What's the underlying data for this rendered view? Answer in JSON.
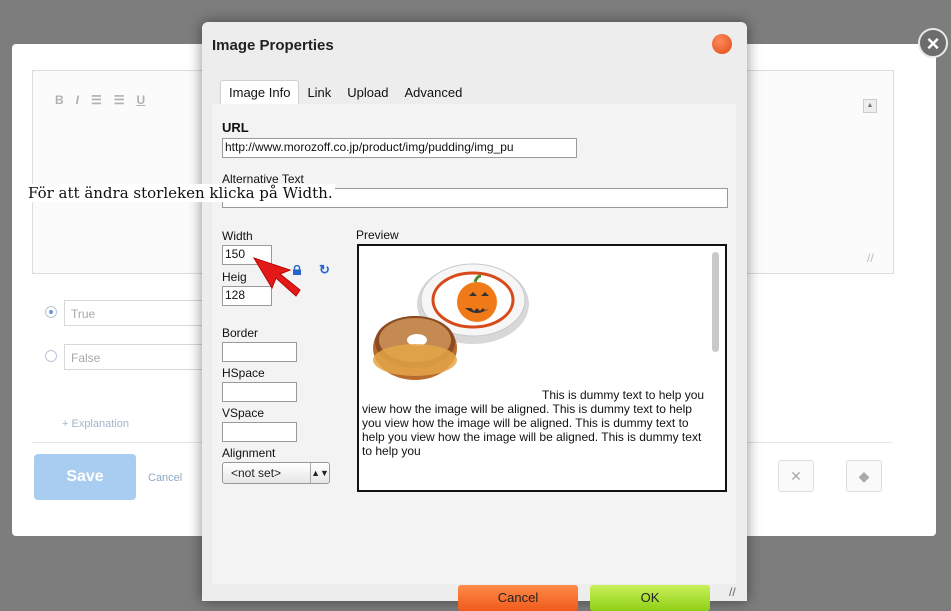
{
  "background": {
    "toolbar_icons": [
      "B",
      "I",
      "☰",
      "☰",
      "U"
    ],
    "options": [
      {
        "label": "True",
        "selected": true
      },
      {
        "label": "False",
        "selected": false
      }
    ],
    "explanation_link": "+ Explanation",
    "save_label": "Save",
    "cancel_label": "Cancel"
  },
  "dialog": {
    "title": "Image Properties",
    "tabs": [
      "Image Info",
      "Link",
      "Upload",
      "Advanced"
    ],
    "active_tab": "Image Info",
    "url_label": "URL",
    "url_value": "http://www.morozoff.co.jp/product/img/pudding/img_pu",
    "alt_label": "Alternative Text",
    "alt_value": "",
    "note": "För att ändra storleken klicka på Width.",
    "width_label": "Width",
    "width_value": "150",
    "height_label": "Heig",
    "height_value": "128",
    "border_label": "Border",
    "hspace_label": "HSpace",
    "vspace_label": "VSpace",
    "alignment_label": "Alignment",
    "alignment_value": "<not set>",
    "preview_label": "Preview",
    "preview_text": "This is dummy text to help you view how the image will be aligned. This is dummy text to help you view how the image will be aligned. This is dummy text to help you view how the image will be aligned. This is dummy text to help you",
    "cancel_label": "Cancel",
    "ok_label": "OK"
  },
  "colors": {
    "cancel_button": "#f06a2a",
    "ok_button": "#a6dc2a",
    "close_button": "#e9531c",
    "save_button": "#a9cdf0"
  }
}
